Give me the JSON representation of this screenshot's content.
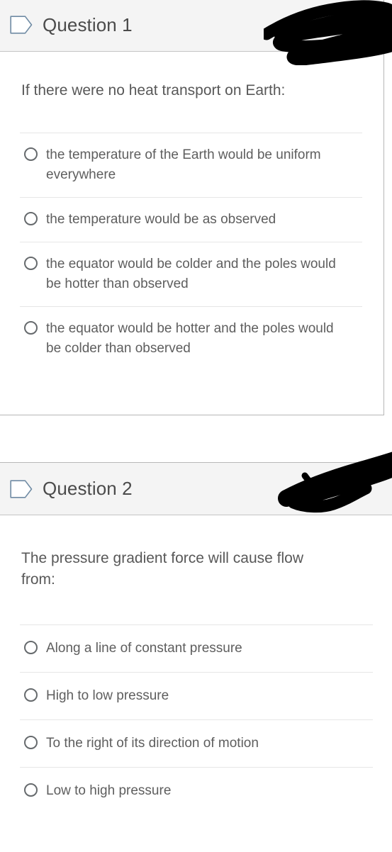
{
  "theme": {
    "page_background": "#ffffff",
    "header_background": "#f4f4f4",
    "header_border": "#c4c4c4",
    "card_border": "#b7b7b7",
    "separator": "#e6e6e6",
    "title_text": "#4b4b4b",
    "body_text": "#585858",
    "answer_text": "#5e5e5e",
    "radio_border": "#666a6d",
    "flag_icon_stroke": "#6f8ba4",
    "redaction_ink": "#000000"
  },
  "questions": [
    {
      "header": {
        "icon": "flag-tag-icon",
        "title": "Question 1",
        "redaction": "scribble-mark"
      },
      "prompt": "If there were no heat transport on Earth:",
      "answers": [
        {
          "label": "the temperature of the Earth would be uniform everywhere",
          "selected": false
        },
        {
          "label": "the temperature would be as observed",
          "selected": false
        },
        {
          "label": "the equator would be colder and the poles would be hotter than observed",
          "selected": false
        },
        {
          "label": "the equator would be hotter and the poles would be colder than observed",
          "selected": false
        }
      ]
    },
    {
      "header": {
        "icon": "flag-tag-icon",
        "title": "Question 2",
        "redaction": "scribble-mark"
      },
      "prompt": "The pressure gradient force will cause flow from:",
      "answers": [
        {
          "label": "Along a line of constant pressure",
          "selected": false
        },
        {
          "label": "High to low pressure",
          "selected": false
        },
        {
          "label": "To the right of its direction of motion",
          "selected": false
        },
        {
          "label": "Low to high pressure",
          "selected": false
        }
      ]
    }
  ]
}
